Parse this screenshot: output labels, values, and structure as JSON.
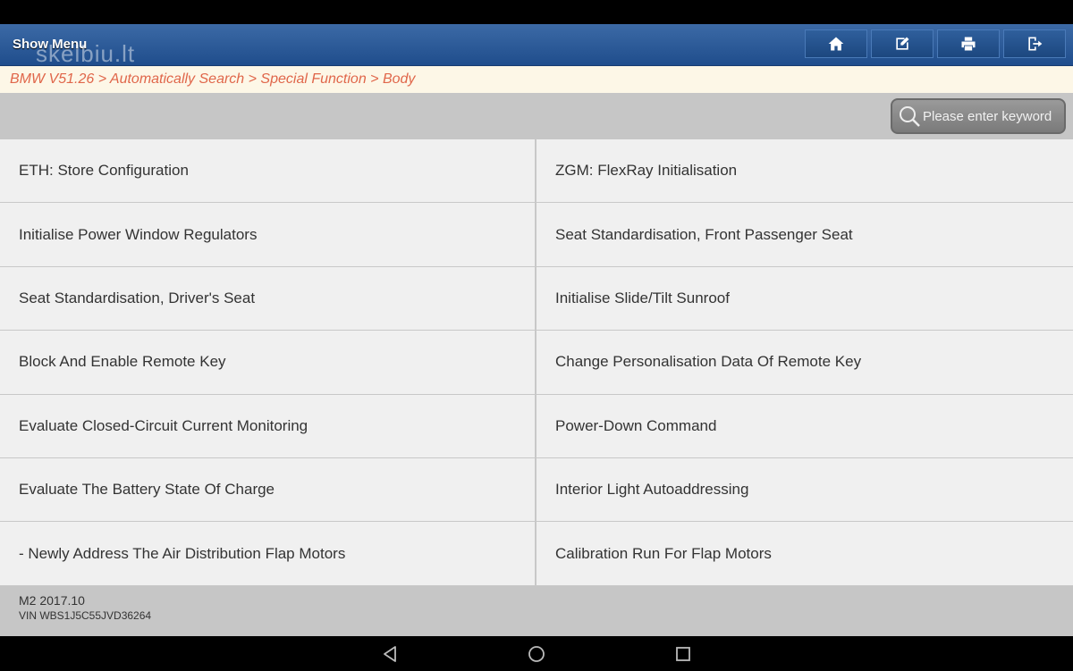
{
  "header": {
    "menu_label": "Show Menu",
    "watermark": "skelbiu.lt",
    "tools": [
      "home-icon",
      "edit-icon",
      "print-icon",
      "exit-icon"
    ]
  },
  "breadcrumb": "BMW V51.26 > Automatically Search > Special Function > Body",
  "search": {
    "placeholder": "Please enter keyword"
  },
  "functions": [
    "ETH: Store Configuration",
    "ZGM: FlexRay Initialisation",
    "Initialise Power Window Regulators",
    "Seat Standardisation, Front Passenger Seat",
    "Seat Standardisation, Driver's Seat",
    "Initialise Slide/Tilt Sunroof",
    "Block And Enable Remote Key",
    "Change Personalisation Data Of Remote Key",
    "Evaluate Closed-Circuit Current Monitoring",
    "Power-Down Command",
    "Evaluate The Battery State Of Charge",
    "Interior Light Autoaddressing",
    "- Newly Address The Air Distribution Flap Motors",
    "Calibration Run For Flap Motors"
  ],
  "footer": {
    "model": "M2 2017.10",
    "vin": "VIN WBS1J5C55JVD36264"
  },
  "colors": {
    "header": "#2a5a98",
    "breadcrumb_text": "#e0664a",
    "breadcrumb_bg": "#fdf7e7",
    "panel_gray": "#c6c6c6"
  }
}
